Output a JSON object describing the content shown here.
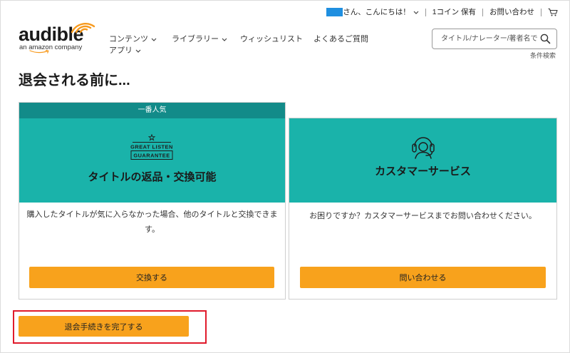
{
  "header": {
    "greeting": "さん、こんにちは！",
    "greeting_icon": "chevron-down-icon",
    "coins": "1コイン 保有",
    "contact": "お問い合わせ",
    "cart_icon": "cart-icon"
  },
  "logo": {
    "wordmark": "audible",
    "tagline": "an amazon company",
    "icon": "audible-wave-icon"
  },
  "nav": {
    "items": [
      {
        "label": "コンテンツ",
        "icon": "chevron-down-icon"
      },
      {
        "label": "ライブラリー",
        "icon": "chevron-down-icon"
      },
      {
        "label": "ウィッシュリスト"
      },
      {
        "label": "よくあるご質問"
      },
      {
        "label": "アプリ",
        "icon": "chevron-down-icon"
      }
    ]
  },
  "search": {
    "placeholder": "タイトル/ナレーター/著者名で",
    "icon": "search-icon",
    "advanced_label": "条件検索"
  },
  "page_title": "退会される前に...",
  "cards": [
    {
      "badge": "一番人気",
      "icon": "great-listen-guarantee-icon",
      "icon_text": [
        "GREAT LISTEN",
        "GUARANTEE"
      ],
      "title": "タイトルの返品・交換可能",
      "body": "購入したタイトルが気に入らなかった場合、他のタイトルと交換できます。",
      "button": "交換する"
    },
    {
      "icon": "headset-icon",
      "title": "カスタマーサービス",
      "body": "お困りですか？カスタマーサービスまでお問い合わせください。",
      "button": "問い合わせる"
    }
  ],
  "cancel": {
    "button": "退会手続きを完了する"
  },
  "colors": {
    "teal": "#1ab3aa",
    "banner": "#128b89",
    "button": "#f8a21c",
    "highlight_outline": "#e01a2b",
    "redaction": "#1f8fe0",
    "logo_orange": "#f7991c"
  }
}
